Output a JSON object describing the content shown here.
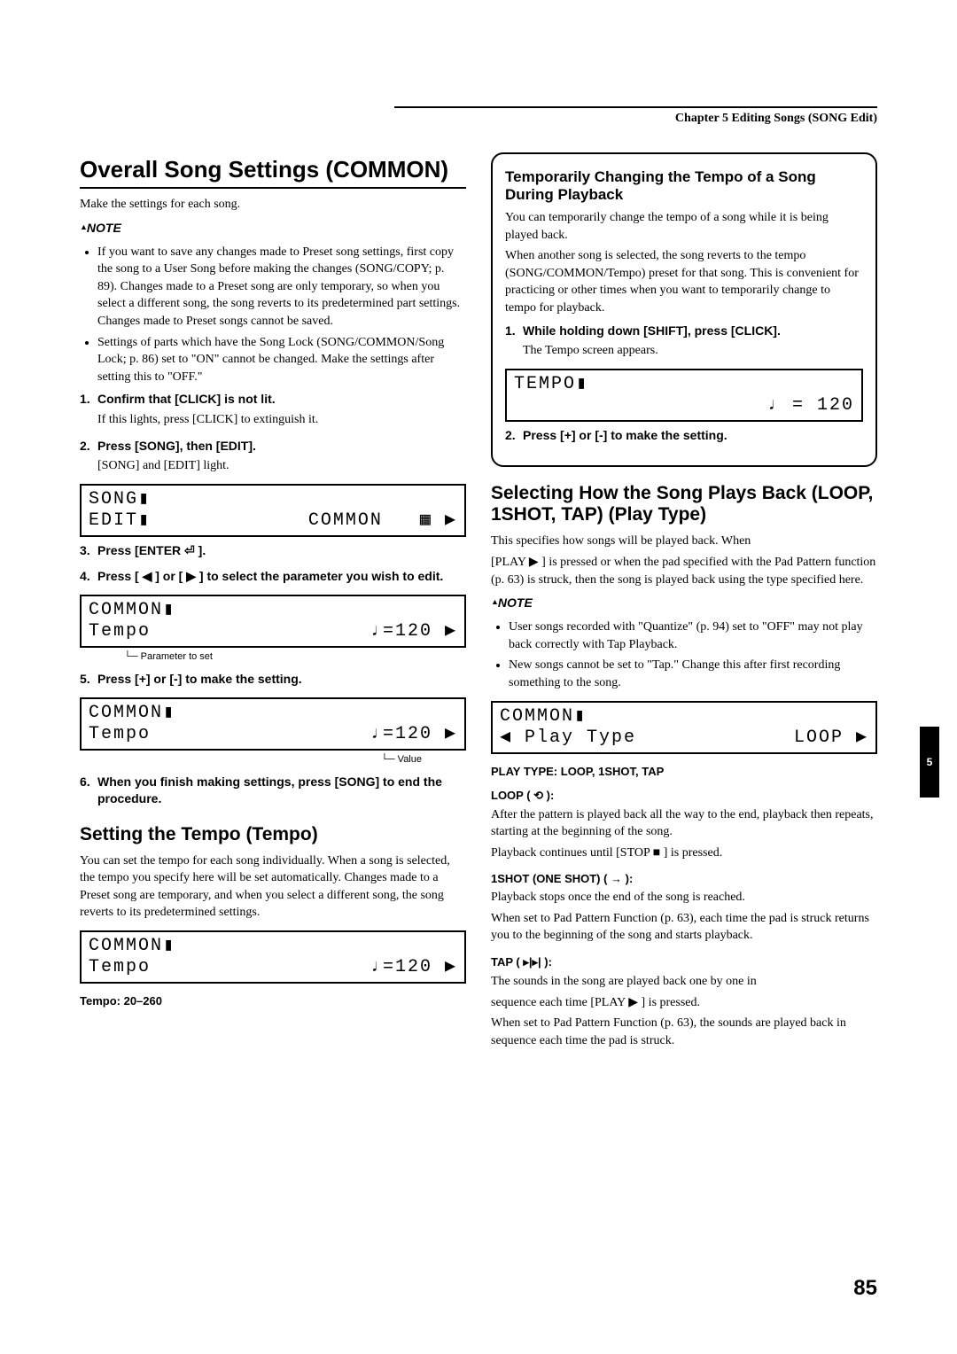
{
  "chapter_header": "Chapter 5 Editing Songs (SONG Edit)",
  "page_number": "85",
  "side_tab": "5",
  "left": {
    "h1": "Overall Song Settings (COMMON)",
    "intro": "Make the settings for each song.",
    "note_label": "NOTE",
    "note_bullets": [
      "If you want to save any changes made to Preset song settings, first copy the song to a User Song before making the changes (SONG/COPY; p. 89). Changes made to a Preset song are only temporary, so when you select a different song, the song reverts to its predetermined part settings. Changes made to Preset songs cannot be saved.",
      "Settings of parts which have the Song Lock (SONG/COMMON/Song Lock; p. 86) set to \"ON\" cannot be changed. Make the settings after setting this to \"OFF.\""
    ],
    "steps": [
      {
        "n": "1.",
        "title": "Confirm that [CLICK] is not lit.",
        "body": "If this lights, press [CLICK] to extinguish it."
      },
      {
        "n": "2.",
        "title": "Press [SONG], then [EDIT].",
        "body": "[SONG] and [EDIT] light."
      },
      {
        "n": "3.",
        "title": "Press [ENTER ⏎ ].",
        "body": ""
      },
      {
        "n": "4.",
        "title": "Press [ ◀ ] or [ ▶ ] to select the parameter you wish to edit.",
        "body": ""
      },
      {
        "n": "5.",
        "title": "Press [+] or [-] to make the setting.",
        "body": ""
      },
      {
        "n": "6.",
        "title": "When you finish making settings, press [SONG] to end the procedure.",
        "body": ""
      }
    ],
    "lcd_song": {
      "l1_left": "SONG▮",
      "l1_right": "",
      "l2_left": "EDIT▮",
      "l2_right": "COMMON   ▦ ▶"
    },
    "lcd_common_a": {
      "l1_left": "COMMON▮",
      "l1_right": "",
      "l2_left": " Tempo",
      "l2_right": "♩=120 ▶"
    },
    "anno_param": "Parameter to set",
    "lcd_common_b": {
      "l1_left": "COMMON▮",
      "l1_right": "",
      "l2_left": " Tempo",
      "l2_right": "♩=120 ▶"
    },
    "anno_value": "Value",
    "h2": "Setting the Tempo (Tempo)",
    "tempo_para": "You can set the tempo for each song individually. When a song is selected, the tempo you specify here will be set automatically. Changes made to a Preset song are temporary, and when you select a different song, the song reverts to its predetermined settings.",
    "lcd_common_c": {
      "l1_left": "COMMON▮",
      "l1_right": "",
      "l2_left": " Tempo",
      "l2_right": "♩=120 ▶"
    },
    "tempo_range": "Tempo: 20–260"
  },
  "right": {
    "box": {
      "h3": "Temporarily Changing the Tempo of a Song During Playback",
      "p1": "You can temporarily change the tempo of a song while it is being played back.",
      "p2": " When another song is selected, the song reverts to the tempo (SONG/COMMON/Tempo) preset for that song. This is convenient for practicing or other times when you want to temporarily change to tempo for playback.",
      "steps": [
        {
          "n": "1.",
          "title": "While holding down [SHIFT], press [CLICK].",
          "body": "The Tempo screen appears."
        },
        {
          "n": "2.",
          "title": "Press [+] or [-] to make the setting.",
          "body": ""
        }
      ],
      "lcd_tempo": {
        "l1_left": "TEMPO▮",
        "l1_right": "",
        "l2_left": "",
        "l2_right": "♩ = 120"
      }
    },
    "h2": "Selecting How the Song Plays Back (LOOP, 1SHOT, TAP) (Play Type)",
    "p1": "This specifies how songs will be played back. When",
    "p2": "[PLAY ▶ ] is pressed or when the pad specified with the Pad Pattern function (p. 63) is struck, then the song is played back using the type specified here.",
    "note_label": "NOTE",
    "note_bullets": [
      "User songs recorded with \"Quantize\" (p. 94) set to \"OFF\" may not play back correctly with Tap Playback.",
      "New songs cannot be set to \"Tap.\" Change this after first recording something to the song."
    ],
    "lcd_playtype": {
      "l1_left": "COMMON▮",
      "l1_right": "",
      "l2_left": "◀ Play Type",
      "l2_right": "LOOP ▶"
    },
    "playtype_head": "PLAY TYPE: LOOP, 1SHOT, TAP",
    "loop_label": "LOOP ( ⟲ ):",
    "loop_text1": "After the pattern is played back all the way to the end, playback then repeats, starting at the beginning of the song.",
    "loop_text2": "Playback continues until [STOP ■ ] is pressed.",
    "oneshot_label": "1SHOT (ONE SHOT) ( → ):",
    "oneshot_text1": "Playback stops once the end of the song is reached.",
    "oneshot_text2": "When set to Pad Pattern Function (p. 63), each time the pad is struck returns you to the beginning of the song and starts playback.",
    "tap_label": "TAP ( ▸|▸| ):",
    "tap_text1": "The sounds in the song are played back one by one in",
    "tap_text2": "sequence each time [PLAY ▶ ] is pressed.",
    "tap_text3": "When set to Pad Pattern Function (p. 63), the sounds are played back in sequence each time the pad is struck."
  }
}
